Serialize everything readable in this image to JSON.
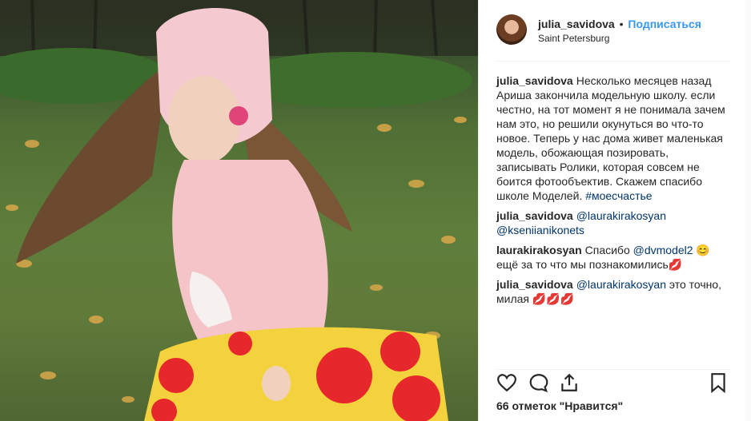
{
  "post": {
    "username": "julia_savidova",
    "separator": "•",
    "follow_label": "Подписаться",
    "location": "Saint Petersburg"
  },
  "comments": [
    {
      "user": "julia_savidova",
      "text": "Несколько месяцев назад Ариша закончила модельную школу. если честно, на тот момент я не понимала зачем нам это, но решили окунуться во что-то новое. Теперь у нас дома живет маленькая модель, обожающая позировать, записывать Ролики, которая совсем не боится фотообъектив. Скажем спасибо школе Моделей. ",
      "hashtag": "#моесчастье"
    },
    {
      "user": "julia_savidova",
      "mention1": "@laurakirakosyan",
      "mention2": "@kseniianikonets"
    },
    {
      "user": "laurakirakosyan",
      "text_before": "Спасибо ",
      "mention": "@dvmodel2",
      "text_after": " 😊ещё за то что мы познакомились💋"
    },
    {
      "user": "julia_savidova",
      "mention": "@laurakirakosyan",
      "text": " это точно, милая 💋💋💋"
    }
  ],
  "likes_text": "66 отметок \"Нравится\"",
  "icons": {
    "like": "heart-icon",
    "comment": "comment-icon",
    "share": "share-icon",
    "save": "bookmark-icon"
  },
  "colors": {
    "link": "#003569",
    "follow": "#3897f0",
    "text": "#262626"
  }
}
